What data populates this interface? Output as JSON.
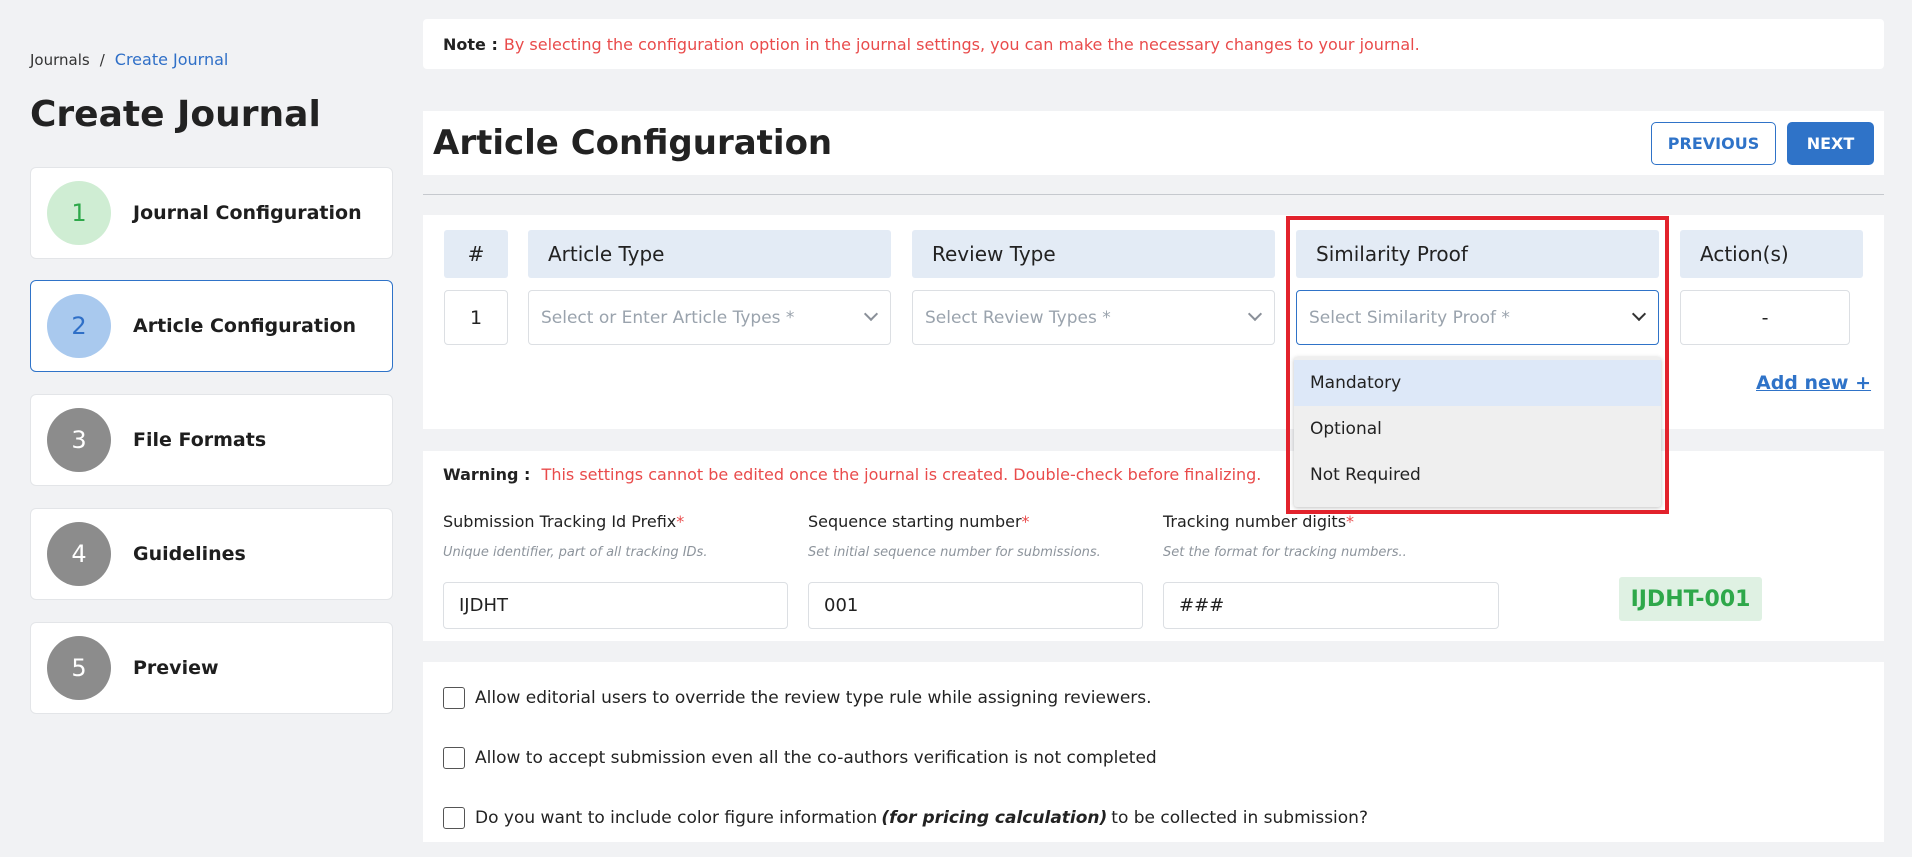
{
  "breadcrumb": {
    "root": "Journals",
    "separator": "/",
    "current": "Create Journal"
  },
  "page_title": "Create Journal",
  "steps": [
    {
      "num": "1",
      "label": "Journal Configuration"
    },
    {
      "num": "2",
      "label": "Article Configuration"
    },
    {
      "num": "3",
      "label": "File Formats"
    },
    {
      "num": "4",
      "label": "Guidelines"
    },
    {
      "num": "5",
      "label": "Preview"
    }
  ],
  "note": {
    "label": "Note :",
    "text": "By selecting the configuration option in the journal settings, you can make the necessary changes to your journal."
  },
  "section_title": "Article Configuration",
  "buttons": {
    "previous": "PREVIOUS",
    "next": "NEXT"
  },
  "table": {
    "headers": [
      "#",
      "Article Type",
      "Review Type",
      "Similarity Proof",
      "Action(s)"
    ],
    "row": {
      "index": "1",
      "article_type_placeholder": "Select or Enter Article Types *",
      "review_type_placeholder": "Select Review Types *",
      "similarity_placeholder": "Select Similarity Proof *",
      "action": "-"
    },
    "add_new": "Add new +"
  },
  "similarity_options": [
    "Mandatory",
    "Optional",
    "Not Required"
  ],
  "warning": {
    "label": "Warning :",
    "text": "This settings cannot be edited once the journal is created. Double-check before finalizing."
  },
  "fields": {
    "prefix": {
      "label": "Submission Tracking Id Prefix",
      "req": "*",
      "hint": "Unique identifier, part of all tracking IDs.",
      "value": "IJDHT"
    },
    "sequence": {
      "label": "Sequence starting number",
      "req": "*",
      "hint": "Set initial sequence number for submissions.",
      "value": "001"
    },
    "digits": {
      "label": "Tracking number digits",
      "req": "*",
      "hint": "Set the format for tracking numbers..",
      "value": "###"
    }
  },
  "preview_badge": "IJDHT-001",
  "checkboxes": {
    "c1": "Allow editorial users to override the review type rule while assigning reviewers.",
    "c2": "Allow to accept submission even all the co-authors verification is not completed",
    "c3_before": "Do you want to include color figure information",
    "c3_em": "(for pricing calculation)",
    "c3_after": "to be collected in submission?"
  },
  "colors": {
    "accent": "#2f73c8",
    "warning": "#e94b4b",
    "success": "#2ea84a",
    "highlight": "#e2222c"
  }
}
